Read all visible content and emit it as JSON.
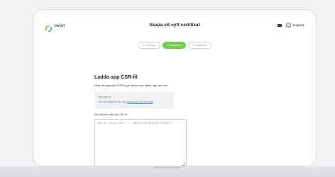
{
  "header": {
    "logo_text": "swish",
    "title": "Skapa ett nytt certifikat",
    "support_label": "Support"
  },
  "steps": [
    {
      "label": "1. Förbered"
    },
    {
      "label": "2. Generera"
    },
    {
      "label": "3. Ladda ner"
    }
  ],
  "main": {
    "heading": "Ladda upp CSR-fil",
    "instruction": "Hitta din sparade CSR-fil på datorn och ladda upp den här.",
    "upload": {
      "file_label": "DIN CSR-FIL",
      "drop_text": "Dra och släpp fil här eller",
      "browse_link": "ladda upp från din dator"
    },
    "paste_label": "Eller klistra in från din CSR-fil",
    "textarea_placeholder": "Börjar oftast med \"-----BEGIN CERTIFICATE REQUEST-----\""
  },
  "colors": {
    "accent_green": "#6fcf4a",
    "link_blue": "#3d8fd8"
  }
}
